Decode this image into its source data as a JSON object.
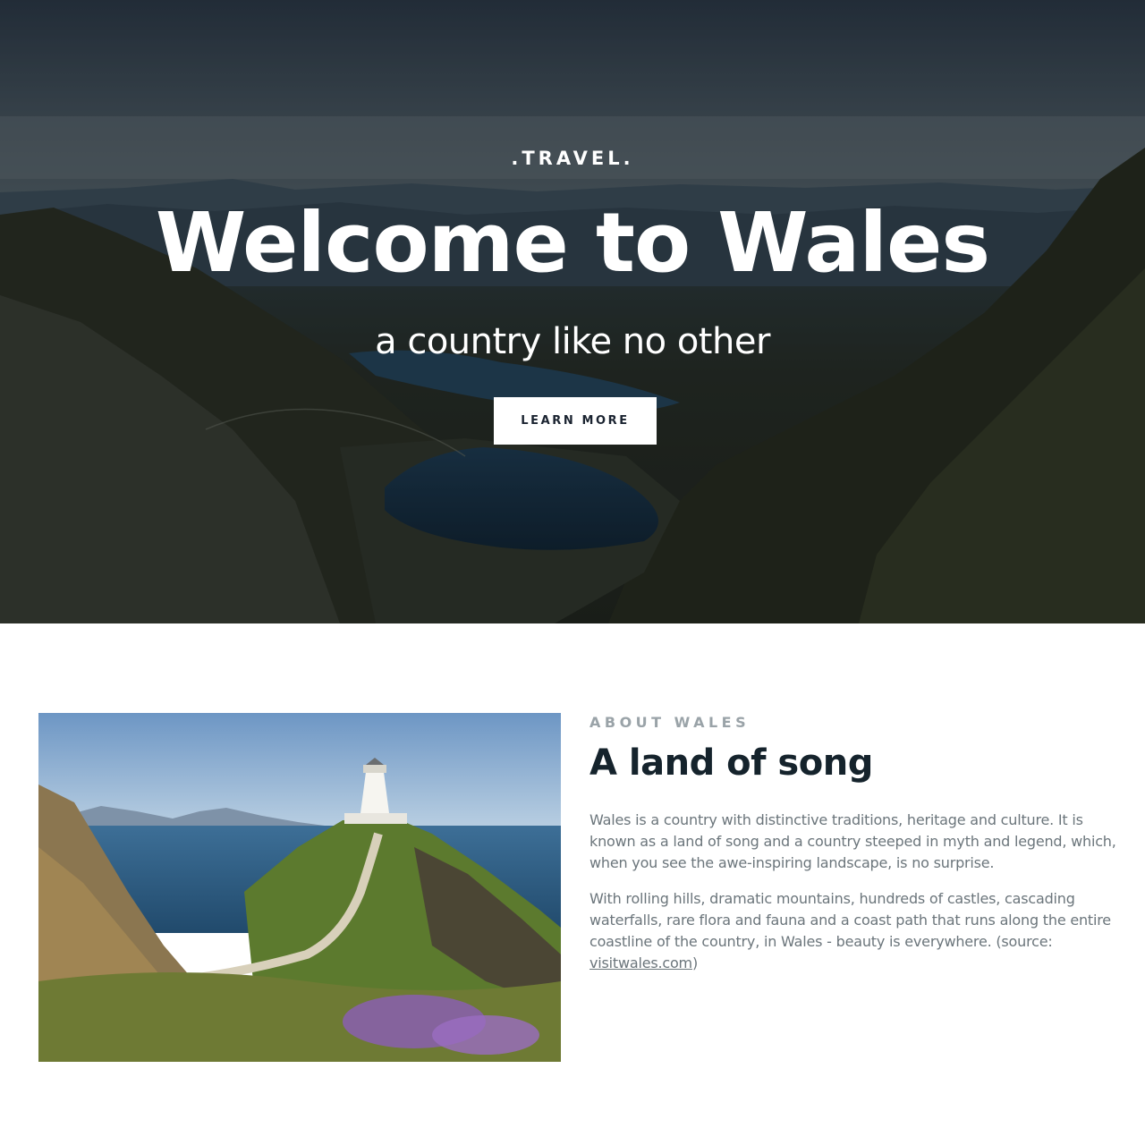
{
  "hero": {
    "kicker": ".TRAVEL.",
    "title": "Welcome to Wales",
    "subtitle": "a country like no other",
    "button_label": "LEARN MORE",
    "background_image": "snowdonia-mountain-lakes-photo"
  },
  "about": {
    "eyebrow": "ABOUT WALES",
    "title": "A land of song",
    "image": "lighthouse-on-headland-photo",
    "paragraph_1": "Wales is a country with distinctive traditions, heritage and culture. It is known as a land of song and a country steeped in myth and legend, which, when you see the awe-inspiring landscape, is no surprise.",
    "paragraph_2_text": "With rolling hills, dramatic mountains, hundreds of castles, cascading waterfalls, rare flora and fauna and a coast path that runs along the entire coastline of the country, in Wales - beauty is everywhere. (source: ",
    "source_link": "visitwales.com",
    "paragraph_2_end": ")"
  },
  "colors": {
    "heading": "#15232c",
    "body_text": "#6b757b",
    "eyebrow": "#9aa3a8",
    "button_bg": "#ffffff",
    "button_text": "#1a2330"
  }
}
